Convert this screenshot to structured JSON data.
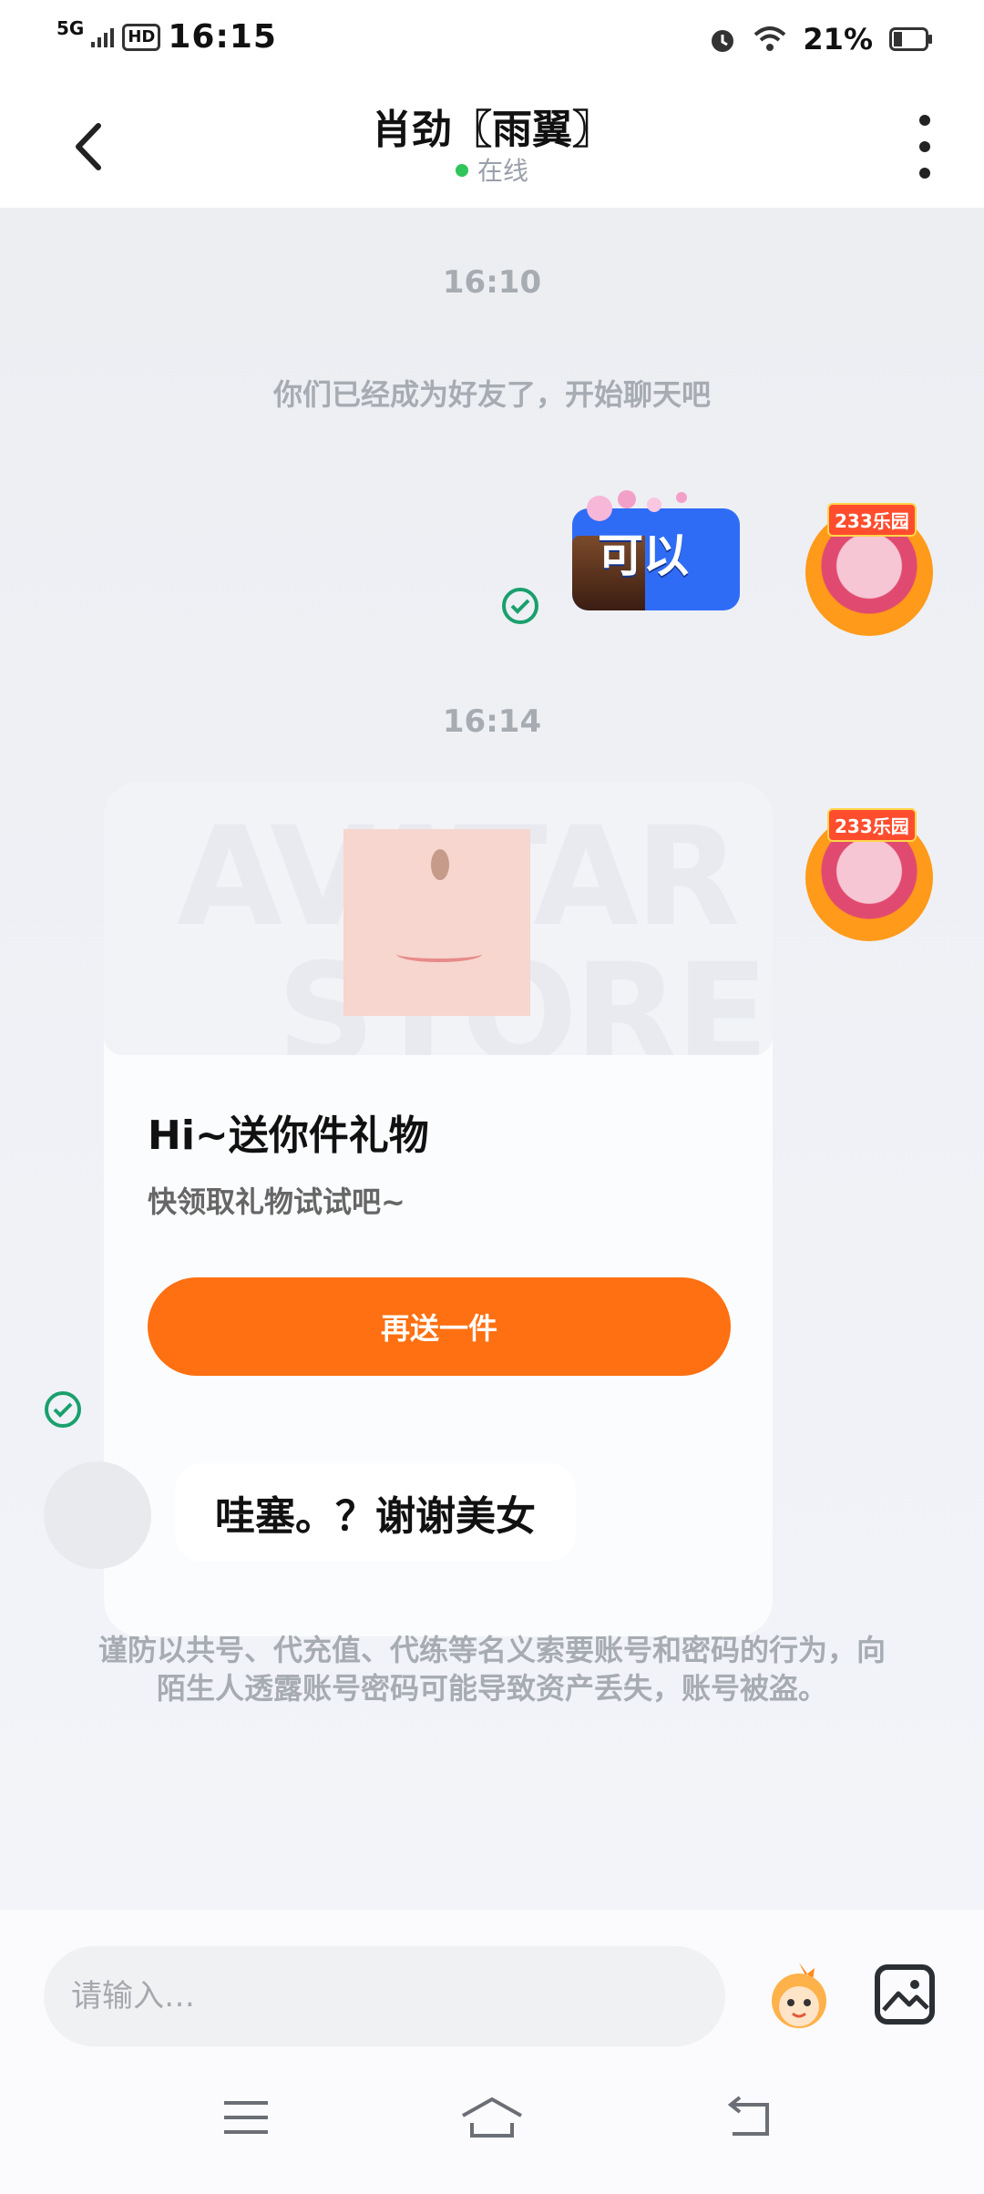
{
  "status_bar": {
    "network": "5G",
    "hd": "HD",
    "time": "16:15",
    "battery": "21%"
  },
  "header": {
    "title": "肖劲〖雨翼〗",
    "status": "在线"
  },
  "chat": {
    "timestamp_1": "16:10",
    "system_message": "你们已经成为好友了，开始聊天吧",
    "sticker_text": "可以",
    "avatar_badge": "233乐园",
    "timestamp_2": "16:14",
    "gift_card": {
      "watermark_line1": "AVATAR",
      "watermark_line2": "STORE",
      "title": "Hi~送你件礼物",
      "subtitle": "快领取礼物试试吧~",
      "button": "再送一件"
    },
    "received_message": "哇塞。？谢谢美女",
    "warning": "谨防以共号、代充值、代练等名义索要账号和密码的行为，向陌生人透露账号密码可能导致资产丢失，账号被盗。"
  },
  "input_bar": {
    "placeholder": "请输入…"
  },
  "colors": {
    "accent_orange": "#ff7012",
    "online_green": "#2fc55a",
    "check_green": "#1aa06d",
    "sticker_blue": "#2f6cf6"
  },
  "icons": [
    "back-icon",
    "more-icon",
    "check-icon",
    "emoji-icon",
    "image-icon",
    "menu-icon",
    "home-icon",
    "return-icon",
    "alarm-icon",
    "wifi-icon",
    "battery-icon"
  ]
}
